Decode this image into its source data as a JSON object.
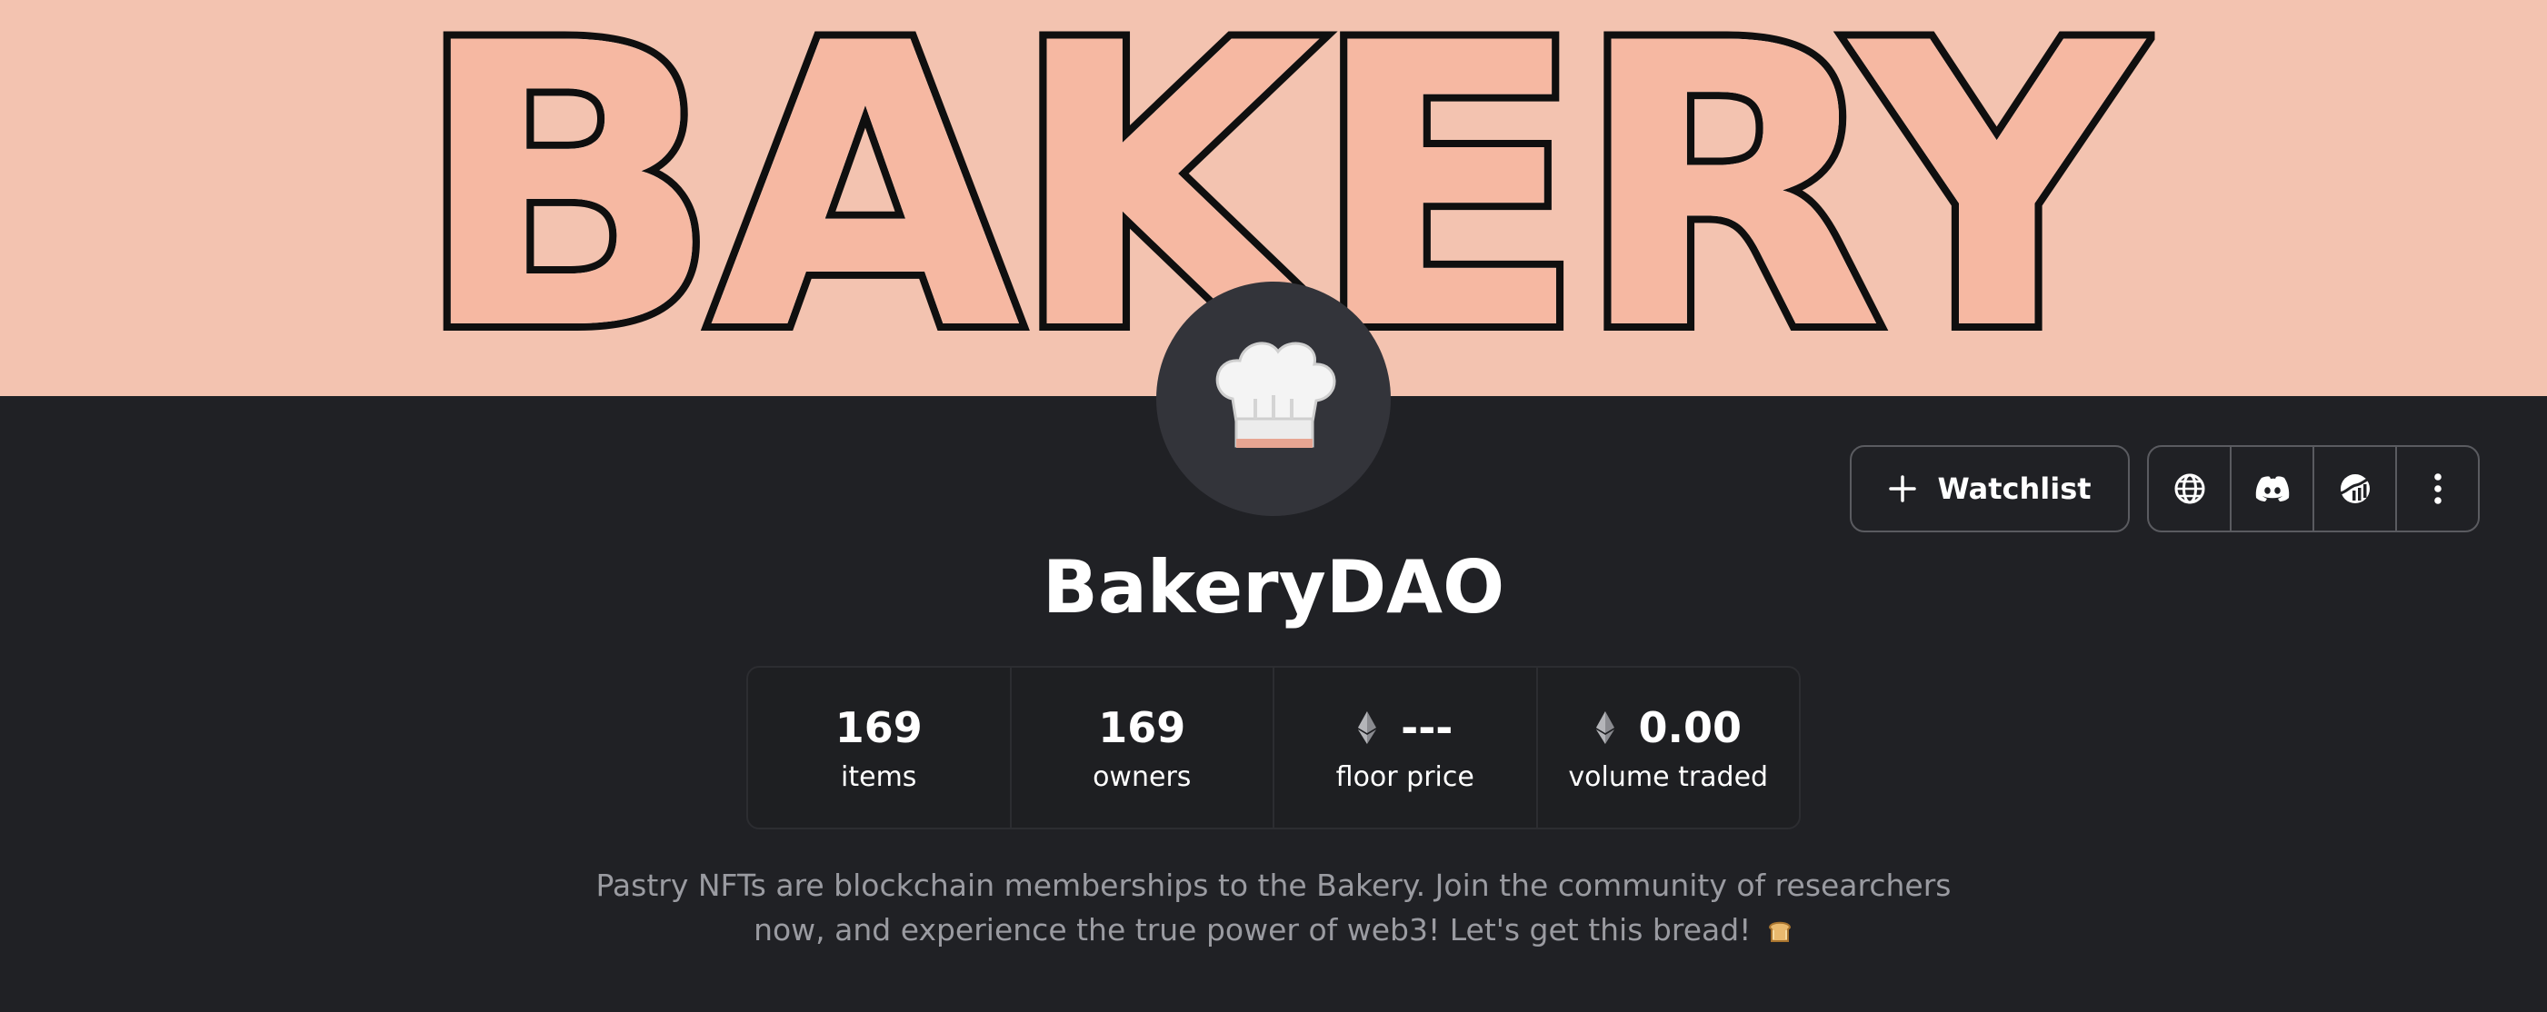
{
  "banner": {
    "text": "BAKERY",
    "colors": {
      "background": "#f3c3b0",
      "letters": "#f6b8a2",
      "outline": "#0f0f0f"
    }
  },
  "avatar": {
    "icon": "chef-hat-icon"
  },
  "actions": {
    "watchlist_label": "Watchlist",
    "icons": [
      "globe-icon",
      "discord-icon",
      "chart-icon",
      "more-vertical-icon"
    ]
  },
  "collection": {
    "name": "BakeryDAO"
  },
  "stats": [
    {
      "value": "169",
      "label": "items",
      "eth": false
    },
    {
      "value": "169",
      "label": "owners",
      "eth": false
    },
    {
      "value": "---",
      "label": "floor price",
      "eth": true
    },
    {
      "value": "0.00",
      "label": "volume traded",
      "eth": true
    }
  ],
  "description": {
    "line1": "Pastry NFTs are blockchain memberships to the Bakery. Join the community of researchers",
    "line2": "now, and experience the true power of web3! Let's get this bread!",
    "trailing_icon": "bread-icon"
  },
  "theme": {
    "background": "#202125",
    "border": "#5a5b60",
    "muted_text": "#9a9ba1"
  }
}
